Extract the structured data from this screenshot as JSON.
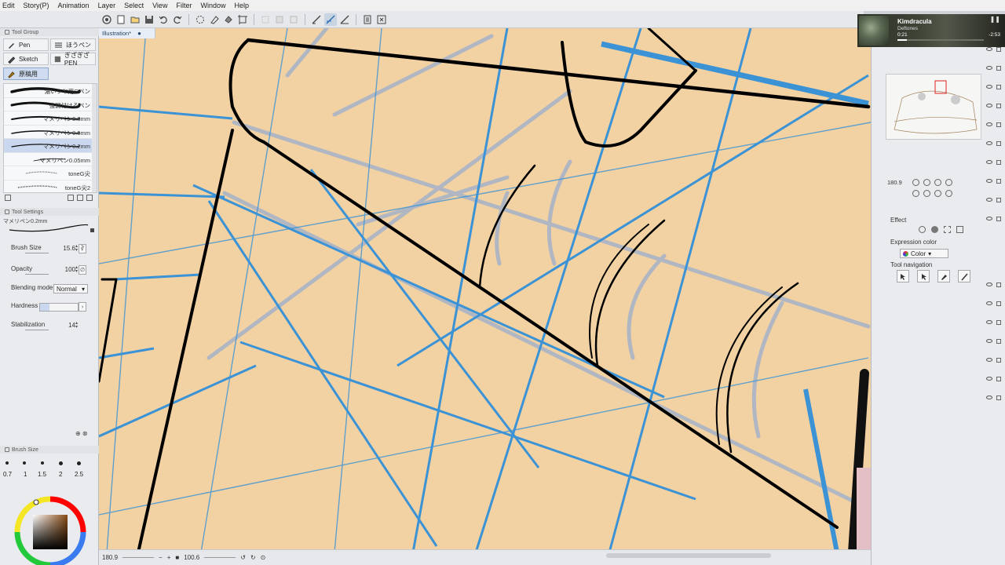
{
  "menu": [
    "Edit",
    "Story(P)",
    "Animation",
    "Layer",
    "Select",
    "View",
    "Filter",
    "Window",
    "Help"
  ],
  "canvas_tab": {
    "title": "Illustration*",
    "close": "●"
  },
  "tool_group": {
    "header": "Tool Group",
    "tools": [
      {
        "label": "Pen",
        "icon": "pen-icon"
      },
      {
        "label": "ほうペン",
        "icon": "brush-list-icon"
      },
      {
        "label": "Sketch",
        "icon": "pencil-icon"
      },
      {
        "label": "ぎざぎざPEN",
        "icon": "stamp-icon"
      },
      {
        "label": "原稿用",
        "icon": "pen-nib-icon"
      }
    ],
    "brushes": [
      "濃いツヤ用Gペン",
      "強弱付けるペン",
      "マメリペン0.8mm",
      "マメリペン0.5mm",
      "マメリペン0.2mm",
      "マメリペン0.05mm",
      "toneG尖",
      "toneG尖2"
    ]
  },
  "tool_settings": {
    "header": "Tool Settings",
    "current_brush": "マメリペン0.2mm",
    "brush_size_label": "Brush Size",
    "brush_size_value": "15.6",
    "opacity_label": "Opacity",
    "opacity_value": "100",
    "blending_label": "Blending mode",
    "blending_value": "Normal",
    "hardness_label": "Hardness",
    "stabilization_label": "Stabilization",
    "stabilization_value": "14"
  },
  "brush_size_palette": {
    "header": "Brush Size",
    "sizes": [
      "0.7",
      "1",
      "1.5",
      "2",
      "2.5"
    ]
  },
  "status": {
    "zoom": "180.9",
    "angle": "100.6"
  },
  "navigator": {
    "zoom": "180.9"
  },
  "right_panel": {
    "effect_label": "Effect",
    "expression_color_label": "Expression color",
    "expression_color_value": "Color",
    "tool_navigation_label": "Tool navigation"
  },
  "media": {
    "title": "Kimdracula",
    "artist": "Deftones",
    "position": "0:21",
    "duration": "-2:53",
    "progress": 0.11
  },
  "colors": {
    "canvas": "#f2d1a3",
    "guide_blue": "#3b93d6",
    "sketch_gray": "#a9b5c6",
    "ink": "#000000",
    "selection": "#c9d8ee"
  }
}
